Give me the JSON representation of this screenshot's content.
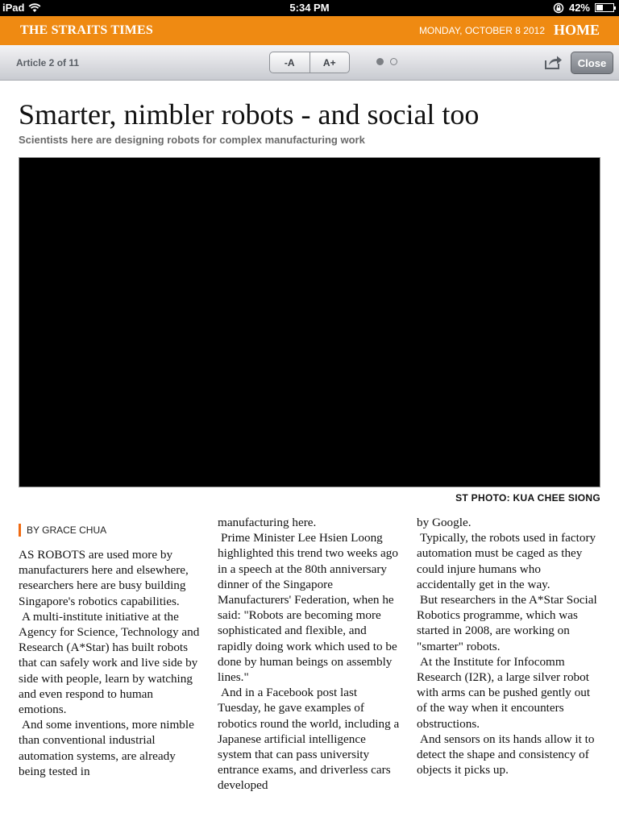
{
  "status_bar": {
    "device": "iPad",
    "time": "5:34 PM",
    "battery": "42%",
    "battery_level": 0.42
  },
  "masthead": {
    "brand": "THE STRAITS TIMES",
    "date": "MONDAY, OCTOBER 8 2012",
    "home_label": "HOME"
  },
  "toolbar": {
    "article_count": "Article 2 of 11",
    "decrease_font": "-A",
    "increase_font": "A+",
    "close_label": "Close",
    "pages_total": 2,
    "page_active": 1
  },
  "article": {
    "headline": "Smarter, nimbler robots - and social too",
    "standfirst": "Scientists here are designing robots for complex manufacturing work",
    "photo_credit": "ST PHOTO: KUA CHEE SIONG",
    "byline": "BY GRACE CHUA",
    "columns": [
      [
        "AS ROBOTS are used more by manufacturers here and elsewhere, researchers here are busy building Singapore's robotics capabilities.",
        "A multi-institute initiative at the Agency for Science, Technology and Research (A*Star) has built robots that can safely work and live side by side with people, learn by watching and even respond to human emotions.",
        "And some inventions, more nimble than conventional industrial automation systems, are already being tested in"
      ],
      [
        "manufacturing here.",
        "Prime Minister Lee Hsien Loong highlighted this trend two weeks ago in a speech at the 80th anniversary dinner of the Singapore Manufacturers' Federation, when he said: \"Robots are becoming more sophisticated and flexible, and rapidly doing work which used to be done by human beings on assembly lines.\"",
        "And in a Facebook post last Tuesday, he gave examples of robotics round the world, including a Japanese artificial intelligence system that can pass university entrance exams, and driverless cars developed"
      ],
      [
        "by Google.",
        "Typically, the robots used in factory automation must be caged as they could injure humans who accidentally get in the way.",
        "But researchers in the A*Star Social Robotics programme, which was started in 2008, are working on \"smarter\" robots.",
        "At the Institute for Infocomm Research (I2R), a large silver robot with arms can be pushed gently out of the way when it encounters obstructions.",
        "And sensors on its hands allow it to detect the shape and consistency of objects it picks up."
      ]
    ]
  },
  "colors": {
    "masthead": "#ef8a12",
    "byline_bar": "#ef6a12"
  },
  "icons": [
    "wifi-icon",
    "rotation-lock-icon",
    "battery-icon",
    "share-icon"
  ]
}
